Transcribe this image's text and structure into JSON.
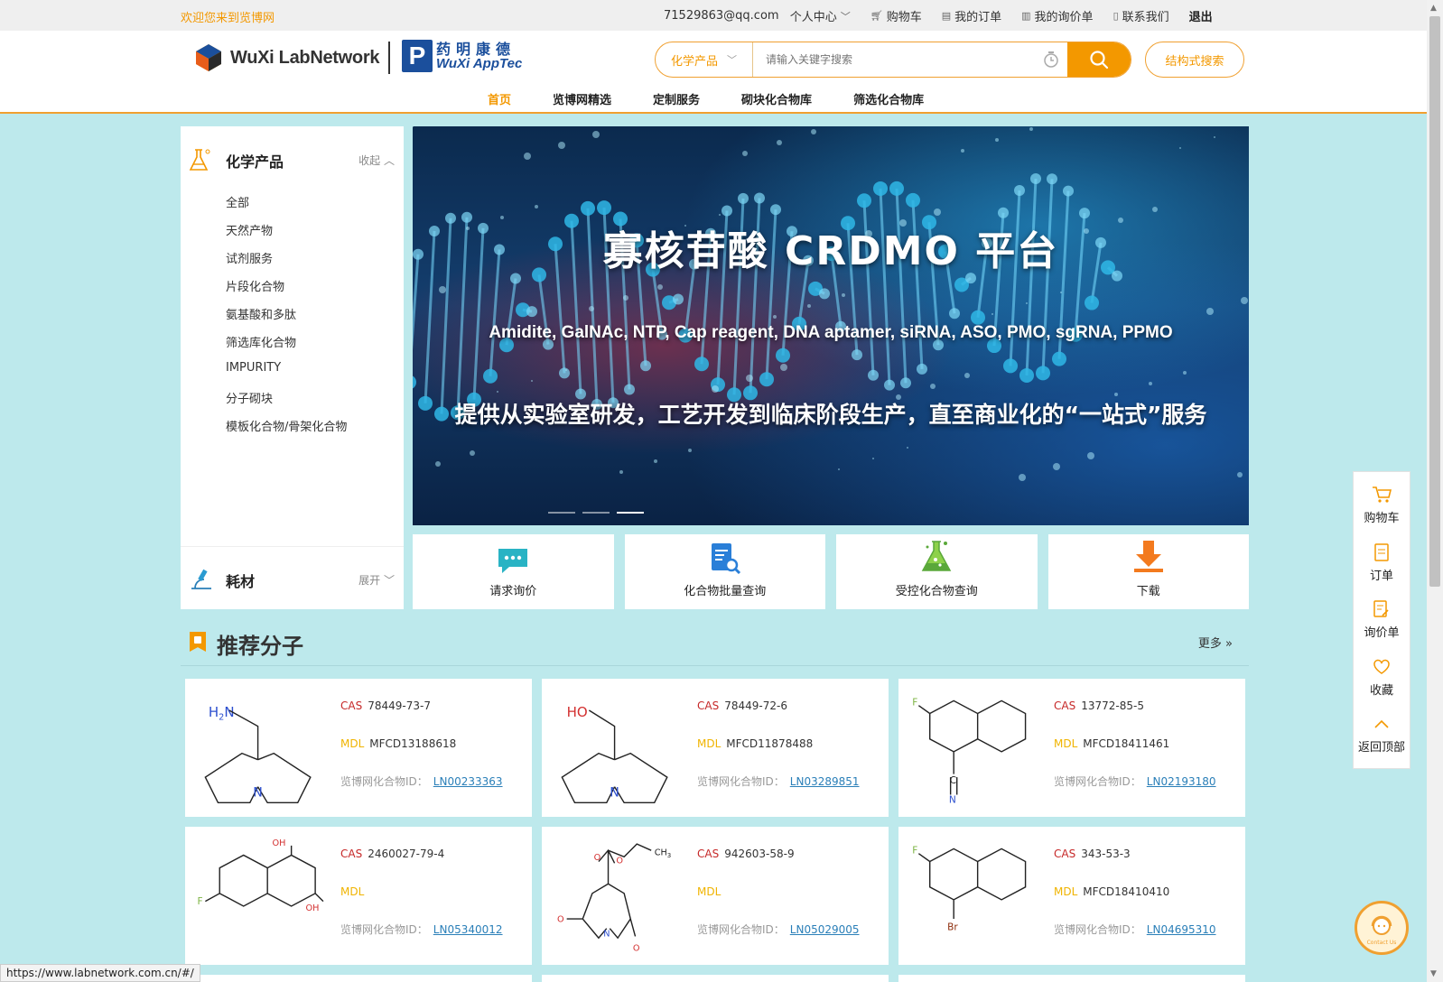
{
  "topbar": {
    "welcome": "欢迎您来到览博网",
    "email": "71529863@qq.com",
    "user_center": "个人中心",
    "cart": "购物车",
    "my_orders": "我的订单",
    "my_inquiries": "我的询价单",
    "contact_us": "联系我们",
    "logout": "退出"
  },
  "header": {
    "logo_left": "WuXi LabNetwork",
    "logo_right_cn": "药明康德",
    "logo_right_en": "WuXi AppTec",
    "search_category": "化学产品",
    "search_placeholder": "请输入关键字搜索",
    "structure_search": "结构式搜索"
  },
  "nav": [
    "首页",
    "览博网精选",
    "定制服务",
    "砌块化合物库",
    "筛选化合物库"
  ],
  "sidebar": {
    "title": "化学产品",
    "collapse_label": "收起",
    "items": [
      "全部",
      "天然产物",
      "试剂服务",
      "片段化合物",
      "氨基酸和多肽",
      "筛选库化合物",
      "IMPURITY",
      "分子砌块",
      "模板化合物/骨架化合物"
    ],
    "footer_title": "耗材",
    "expand_label": "展开"
  },
  "banner": {
    "title": "寡核苷酸 CRDMO 平台",
    "subtitle": "Amidite, GalNAc, NTP, Cap reagent, DNA aptamer, siRNA, ASO, PMO, sgRNA, PPMO",
    "tagline": "提供从实验室研发，工艺开发到临床阶段生产，直至商业化的“一站式”服务",
    "slide_count": 3,
    "active_slide": 3
  },
  "tiles": [
    {
      "label": "请求询价",
      "icon": "chat-icon"
    },
    {
      "label": "化合物批量查询",
      "icon": "document-search-icon"
    },
    {
      "label": "受控化合物查询",
      "icon": "flask-icon"
    },
    {
      "label": "下载",
      "icon": "download-icon"
    }
  ],
  "recommended": {
    "title": "推荐分子",
    "more": "更多",
    "cas_label": "CAS",
    "mdl_label": "MDL",
    "id_label": "览博网化合物ID：",
    "cards": [
      {
        "cas": "78449-73-7",
        "mdl": "MFCD13188618",
        "id": "LN00233363"
      },
      {
        "cas": "78449-72-6",
        "mdl": "MFCD11878488",
        "id": "LN03289851"
      },
      {
        "cas": "13772-85-5",
        "mdl": "MFCD18411461",
        "id": "LN02193180"
      },
      {
        "cas": "2460027-79-4",
        "mdl": "",
        "id": "LN05340012"
      },
      {
        "cas": "942603-58-9",
        "mdl": "",
        "id": "LN05029005"
      },
      {
        "cas": "343-53-3",
        "mdl": "MFCD18410410",
        "id": "LN04695310"
      }
    ]
  },
  "floatbar": [
    "购物车",
    "订单",
    "询价单",
    "收藏",
    "返回顶部"
  ],
  "contact_badge": "Contact Us",
  "status_url": "https://www.labnetwork.com.cn/#/",
  "colors": {
    "accent": "#f39800",
    "link": "#2a7fb8",
    "page_bg": "#bde9ec"
  }
}
